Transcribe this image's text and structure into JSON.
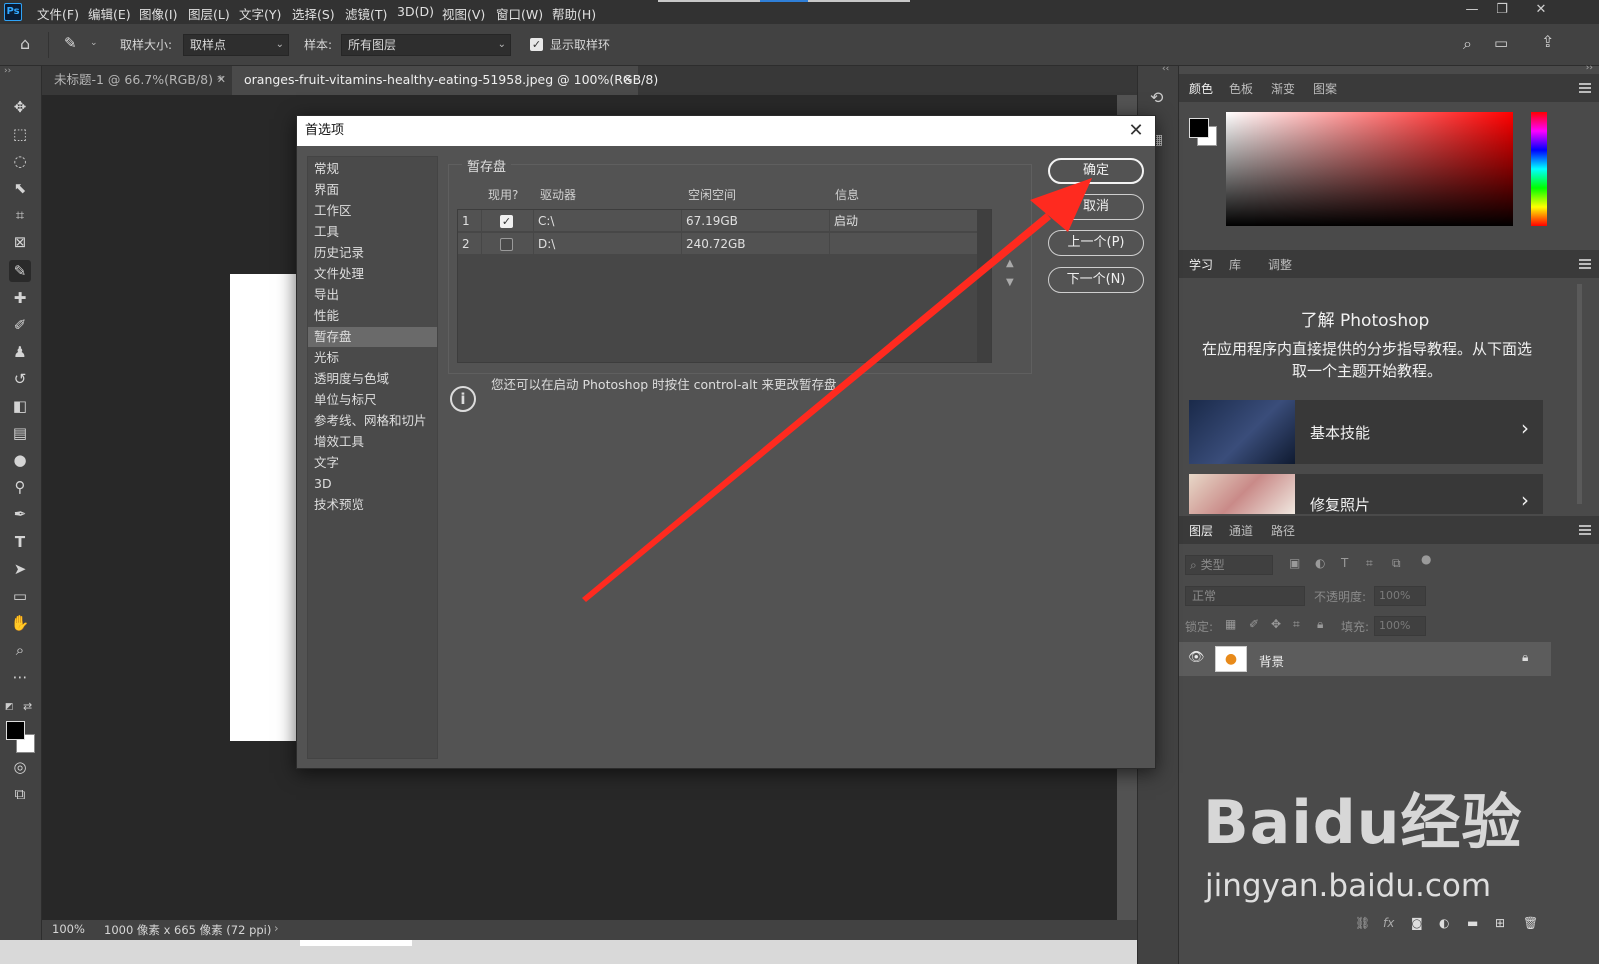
{
  "app": {
    "logo": "Ps"
  },
  "menu": [
    "文件(F)",
    "编辑(E)",
    "图像(I)",
    "图层(L)",
    "文字(Y)",
    "选择(S)",
    "滤镜(T)",
    "3D(D)",
    "视图(V)",
    "窗口(W)",
    "帮助(H)"
  ],
  "options": {
    "sample_size_label": "取样大小:",
    "sample_size_value": "取样点",
    "sample_label": "样本:",
    "sample_value": "所有图层",
    "show_ring_label": "显示取样环"
  },
  "tabs": [
    {
      "label": "未标题-1 @ 66.7%(RGB/8) *"
    },
    {
      "label": "oranges-fruit-vitamins-healthy-eating-51958.jpeg @ 100%(RGB/8)"
    }
  ],
  "status": {
    "zoom": "100%",
    "info": "1000 像素 x 665 像素 (72 ppi)"
  },
  "dialog": {
    "title": "首选项",
    "nav": [
      "常规",
      "界面",
      "工作区",
      "工具",
      "历史记录",
      "文件处理",
      "导出",
      "性能",
      "暂存盘",
      "光标",
      "透明度与色域",
      "单位与标尺",
      "参考线、网格和切片",
      "增效工具",
      "文字",
      "3D",
      "技术预览"
    ],
    "selected_nav": "暂存盘",
    "section_title": "暂存盘",
    "table_headers": [
      "现用?",
      "驱动器",
      "空闲空间",
      "信息"
    ],
    "rows": [
      {
        "num": "1",
        "checked": true,
        "drive": "C:\\",
        "free": "67.19GB",
        "info": "启动"
      },
      {
        "num": "2",
        "checked": false,
        "drive": "D:\\",
        "free": "240.72GB",
        "info": ""
      }
    ],
    "info_text": "您还可以在启动 Photoshop 时按住 control-alt 来更改暂存盘。",
    "buttons": {
      "ok": "确定",
      "cancel": "取消",
      "prev": "上一个(P)",
      "next": "下一个(N)"
    }
  },
  "color_panel": {
    "tabs": [
      "颜色",
      "色板",
      "渐变",
      "图案"
    ],
    "fg": "#000000",
    "bg": "#ffffff",
    "hue": "#ff0000"
  },
  "learn_panel": {
    "tabs": [
      "学习",
      "库",
      "调整"
    ],
    "title": "了解 Photoshop",
    "desc": "在应用程序内直接提供的分步指导教程。从下面选取一个主题开始教程。",
    "cards": [
      "基本技能",
      "修复照片"
    ]
  },
  "layers_panel": {
    "tabs": [
      "图层",
      "通道",
      "路径"
    ],
    "filter_placeholder": "类型",
    "blend": "正常",
    "opacity_label": "不透明度:",
    "opacity": "100%",
    "lock_label": "锁定:",
    "fill_label": "填充:",
    "fill": "100%",
    "layer_name": "背景"
  },
  "watermark": {
    "brand": "Baidu经验",
    "url": "jingyan.baidu.com"
  },
  "colors": {
    "accent_arrow": "#ff2a1f",
    "panel_bg": "#4a4a4a",
    "dialog_bg": "#535353"
  }
}
